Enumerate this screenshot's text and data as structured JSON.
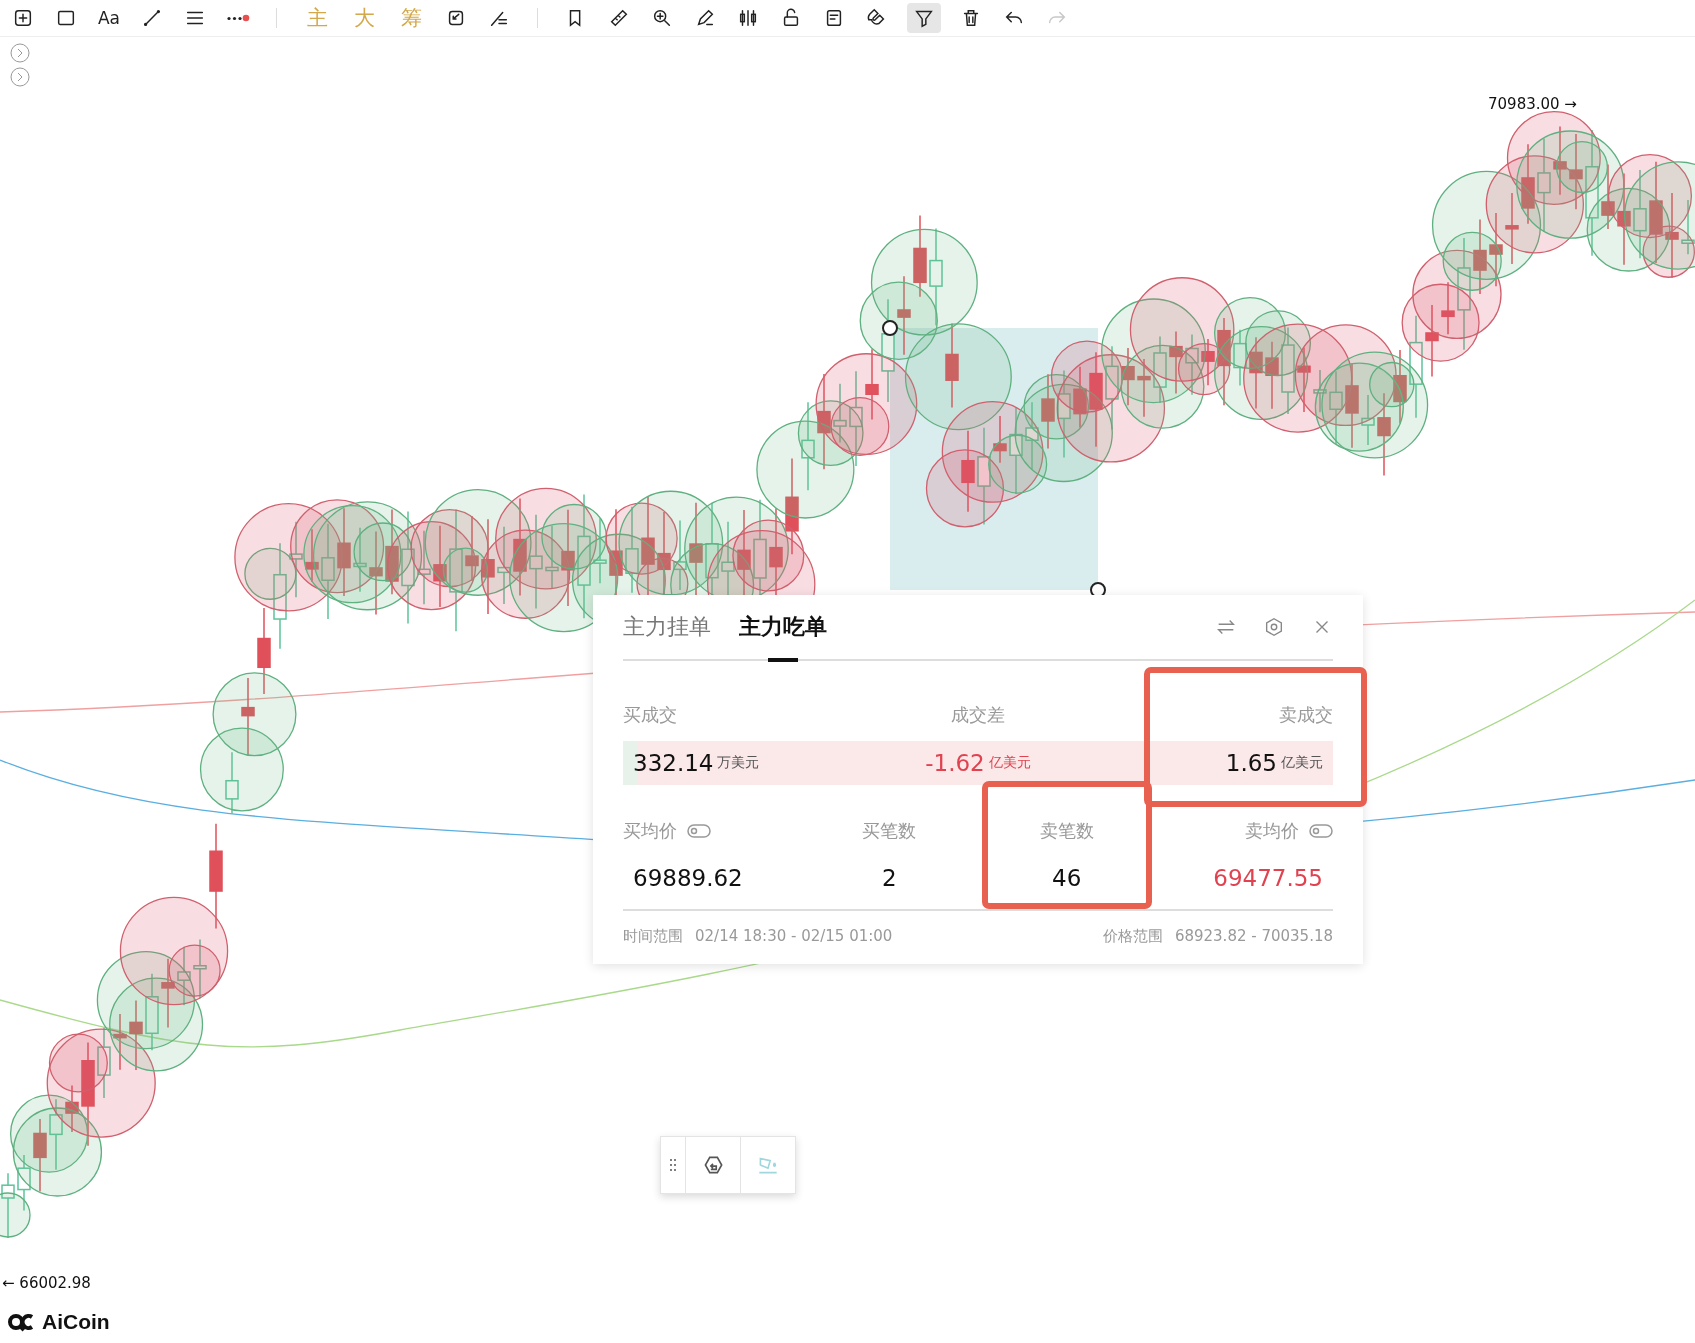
{
  "toolbar": {
    "groups": [
      [
        {
          "kind": "add",
          "selected": false,
          "disabled": false
        },
        {
          "kind": "rect",
          "selected": false,
          "disabled": false
        },
        {
          "kind": "text",
          "label": "Aa",
          "selected": false,
          "disabled": false
        },
        {
          "kind": "line",
          "selected": false,
          "disabled": false
        },
        {
          "kind": "lines",
          "selected": false,
          "disabled": false
        },
        {
          "kind": "more",
          "selected": false,
          "disabled": false
        }
      ],
      [
        {
          "kind": "char",
          "label": "主",
          "selected": false,
          "disabled": false
        },
        {
          "kind": "char",
          "label": "大",
          "selected": false,
          "disabled": false
        },
        {
          "kind": "char",
          "label": "筹",
          "selected": false,
          "disabled": false
        },
        {
          "kind": "swap",
          "selected": false,
          "disabled": false
        },
        {
          "kind": "cross",
          "selected": false,
          "disabled": false
        }
      ],
      [
        {
          "kind": "bookmark",
          "selected": false,
          "disabled": false
        },
        {
          "kind": "ruler",
          "selected": false,
          "disabled": false
        },
        {
          "kind": "zoom",
          "selected": false,
          "disabled": false
        },
        {
          "kind": "pen",
          "selected": false,
          "disabled": false
        },
        {
          "kind": "candles",
          "selected": false,
          "disabled": false
        },
        {
          "kind": "lock",
          "selected": false,
          "disabled": false
        },
        {
          "kind": "note",
          "selected": false,
          "disabled": false
        },
        {
          "kind": "magnet",
          "selected": false,
          "disabled": false
        },
        {
          "kind": "filter",
          "selected": true,
          "disabled": false
        },
        {
          "kind": "trash",
          "selected": false,
          "disabled": false
        },
        {
          "kind": "undo",
          "selected": false,
          "disabled": false
        },
        {
          "kind": "redo",
          "selected": false,
          "disabled": true
        }
      ]
    ]
  },
  "chart": {
    "high_label": "70983.00 →",
    "low_label": "← 66002.98"
  },
  "panel": {
    "tabs": [
      {
        "label": "主力挂单",
        "selected": false
      },
      {
        "label": "主力吃单",
        "selected": true
      }
    ],
    "totals": {
      "level": 0.02,
      "items": [
        {
          "label": "买成交",
          "value": "332.14",
          "unit": "万美元",
          "color": "#111111",
          "highlighted": false
        },
        {
          "label": "成交差",
          "value": "-1.62",
          "unit": "亿美元",
          "color": "#e0434f",
          "highlighted": false
        },
        {
          "label": "卖成交",
          "value": "1.65",
          "unit": "亿美元",
          "color": "#111111",
          "highlighted": true
        }
      ]
    },
    "details": [
      {
        "label": "买均价",
        "toggle": true,
        "value": "69889.62",
        "color": "#111111",
        "highlighted": false
      },
      {
        "label": "买笔数",
        "toggle": false,
        "value": "2",
        "color": "#111111",
        "highlighted": false
      },
      {
        "label": "卖笔数",
        "toggle": false,
        "value": "46",
        "color": "#111111",
        "highlighted": true
      },
      {
        "label": "卖均价",
        "toggle": true,
        "value": "69477.55",
        "color": "#e0434f",
        "highlighted": false
      }
    ],
    "footer": [
      {
        "label": "时间范围",
        "value": "02/14 18:30 - 02/15 01:00"
      },
      {
        "label": "价格范围",
        "value": "68923.82 - 70035.18"
      }
    ]
  },
  "logo": {
    "name": "AiCoin"
  }
}
